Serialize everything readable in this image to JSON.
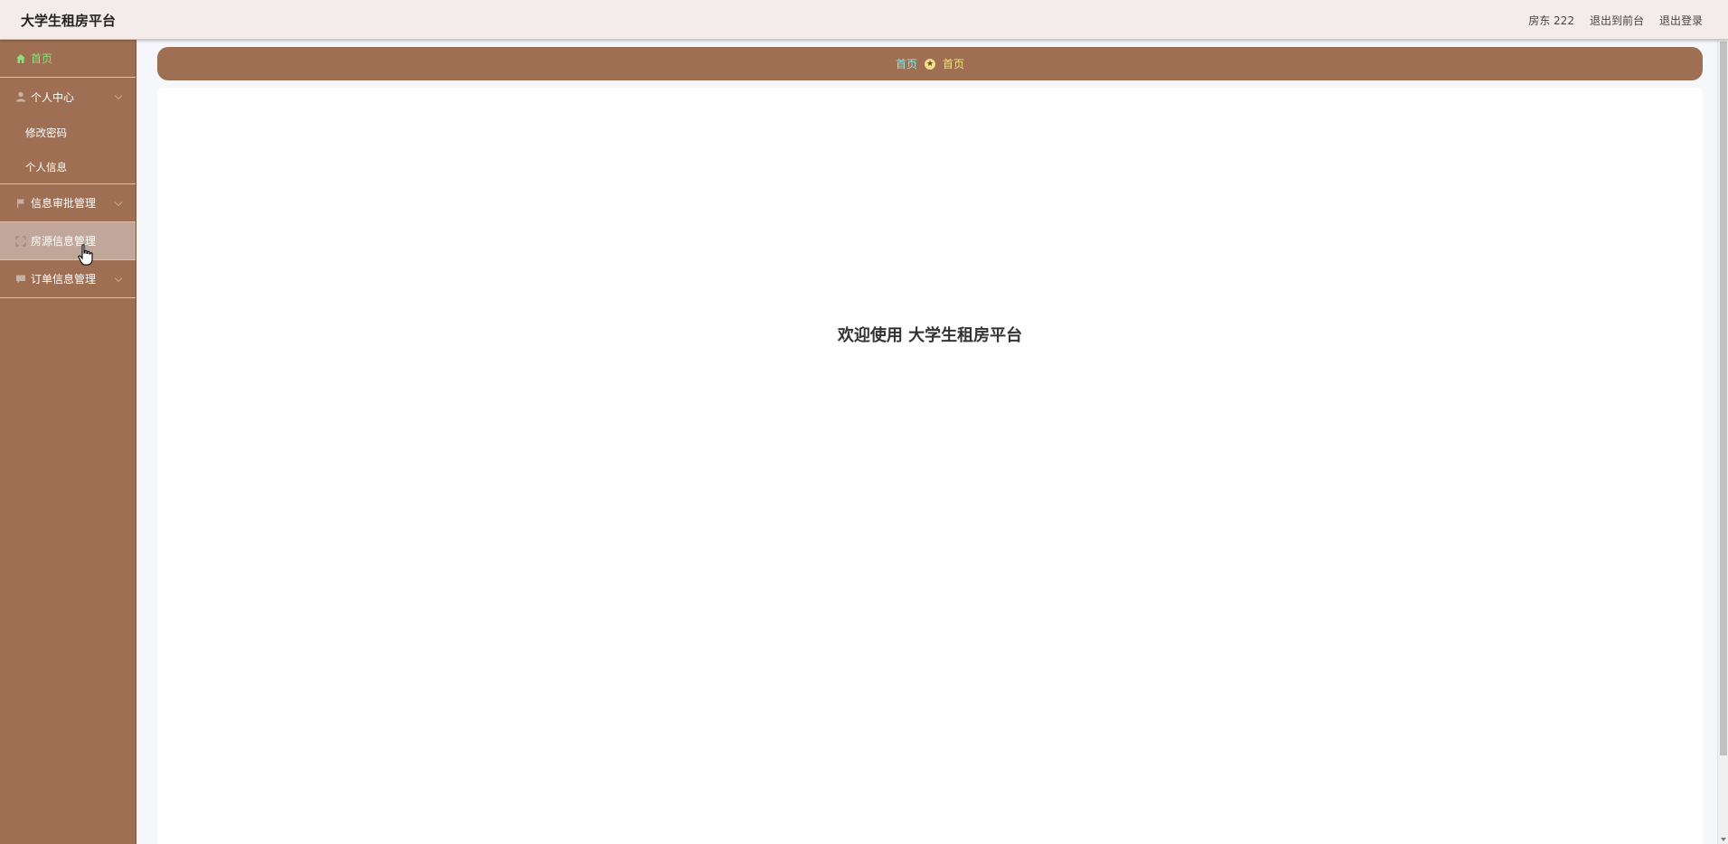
{
  "header": {
    "title": "大学生租房平台",
    "links": {
      "user": "房东 222",
      "front": "退出到前台",
      "logout": "退出登录"
    }
  },
  "sidebar": {
    "home": "首页",
    "groups": [
      {
        "label": "个人中心",
        "icon": "user-icon",
        "children": [
          "修改密码",
          "个人信息"
        ]
      },
      {
        "label": "信息审批管理",
        "icon": "flag-icon",
        "children": []
      },
      {
        "label": "房源信息管理",
        "icon": "frame-icon",
        "children": []
      },
      {
        "label": "订单信息管理",
        "icon": "chat-icon",
        "children": []
      }
    ]
  },
  "breadcrumb": {
    "home": "首页",
    "current": "首页"
  },
  "main": {
    "welcome": "欢迎使用 大学生租房平台"
  },
  "colors": {
    "sidebar": "#9e6f53",
    "active_home": "#8be07a",
    "breadcrumb_link": "#8fe6e0",
    "breadcrumb_current": "#f6e37a"
  }
}
